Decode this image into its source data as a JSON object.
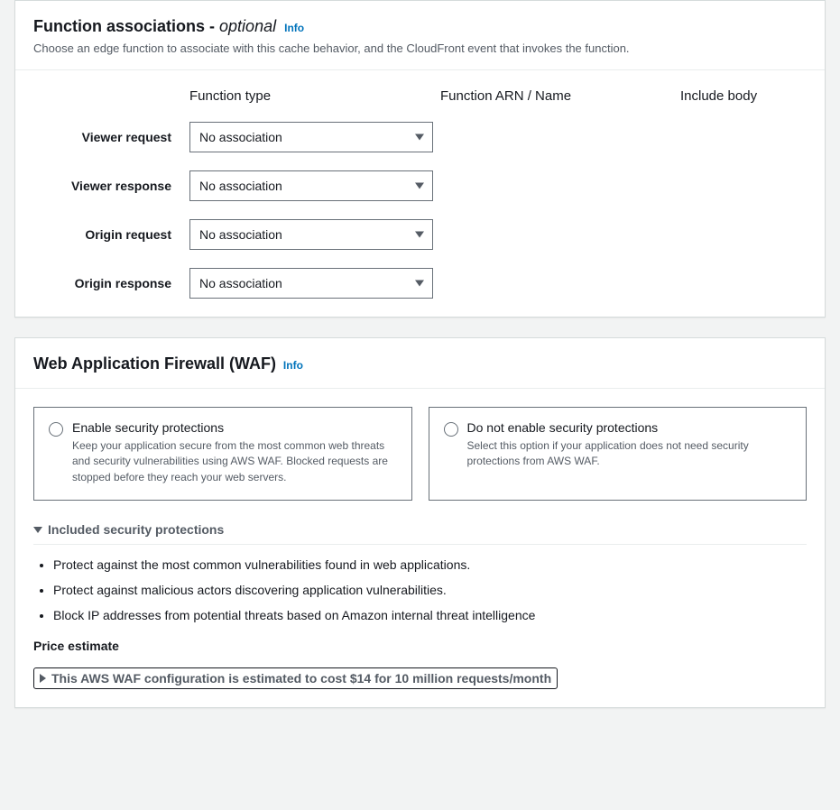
{
  "functionAssociations": {
    "title": "Function associations - ",
    "optionalText": "optional",
    "infoLabel": "Info",
    "description": "Choose an edge function to associate with this cache behavior, and the CloudFront event that invokes the function.",
    "columns": {
      "functionType": "Function type",
      "functionArn": "Function ARN / Name",
      "includeBody": "Include body"
    },
    "rows": [
      {
        "label": "Viewer request",
        "value": "No association"
      },
      {
        "label": "Viewer response",
        "value": "No association"
      },
      {
        "label": "Origin request",
        "value": "No association"
      },
      {
        "label": "Origin response",
        "value": "No association"
      }
    ]
  },
  "waf": {
    "title": "Web Application Firewall (WAF)",
    "infoLabel": "Info",
    "options": {
      "enable": {
        "title": "Enable security protections",
        "desc": "Keep your application secure from the most common web threats and security vulnerabilities using AWS WAF. Blocked requests are stopped before they reach your web servers."
      },
      "disable": {
        "title": "Do not enable security protections",
        "desc": "Select this option if your application does not need security protections from AWS WAF."
      }
    },
    "included": {
      "header": "Included security protections",
      "items": [
        "Protect against the most common vulnerabilities found in web applications.",
        "Protect against malicious actors discovering application vulnerabilities.",
        "Block IP addresses from potential threats based on Amazon internal threat intelligence"
      ]
    },
    "priceLabel": "Price estimate",
    "priceEstimate": "This AWS WAF configuration is estimated to cost $14 for 10 million requests/month"
  }
}
